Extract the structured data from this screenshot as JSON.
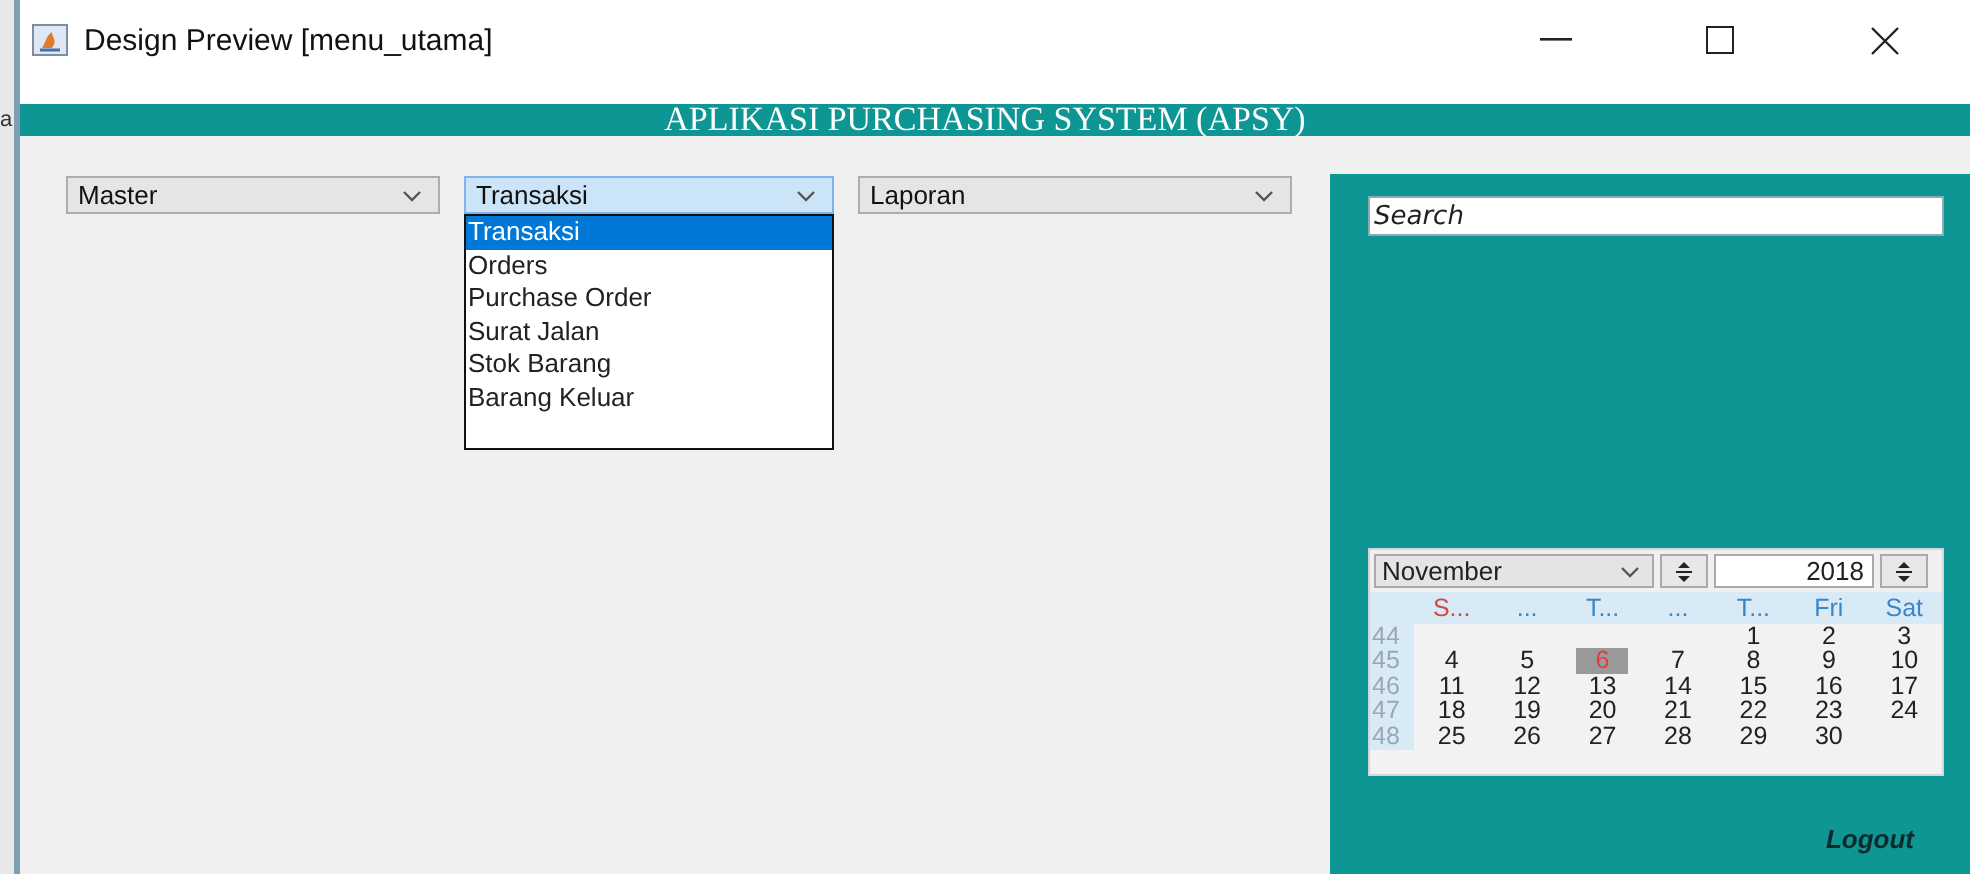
{
  "background_fragment": "a",
  "window": {
    "title": "Design Preview [menu_utama]"
  },
  "banner": {
    "title": "APLIKASI PURCHASING SYSTEM (APSY)"
  },
  "menus": [
    {
      "label": "Master",
      "expanded": false
    },
    {
      "label": "Transaksi",
      "expanded": true,
      "items": [
        {
          "label": "Transaksi",
          "selected": true
        },
        {
          "label": "Orders",
          "selected": false
        },
        {
          "label": "Purchase Order",
          "selected": false
        },
        {
          "label": "Surat Jalan",
          "selected": false
        },
        {
          "label": "Stok Barang",
          "selected": false
        },
        {
          "label": "Barang Keluar",
          "selected": false
        }
      ]
    },
    {
      "label": "Laporan",
      "expanded": false
    }
  ],
  "search": {
    "placeholder": "Search"
  },
  "calendar": {
    "month": "November",
    "year": "2018",
    "weekdays": [
      {
        "label": "S...",
        "color": "#d04848"
      },
      {
        "label": "...",
        "color": "#3a86c8"
      },
      {
        "label": "T...",
        "color": "#3a86c8"
      },
      {
        "label": "...",
        "color": "#3a86c8"
      },
      {
        "label": "T...",
        "color": "#3a86c8"
      },
      {
        "label": "Fri",
        "color": "#3a86c8"
      },
      {
        "label": "Sat",
        "color": "#3a86c8"
      }
    ],
    "weeks": [
      {
        "week": "44",
        "kind": "partial_start",
        "days": [
          {
            "label": "1",
            "selected": false
          },
          {
            "label": "2",
            "selected": false
          },
          {
            "label": "3",
            "selected": false
          }
        ]
      },
      {
        "week": "45",
        "days": [
          {
            "label": "4",
            "selected": false
          },
          {
            "label": "5",
            "selected": false
          },
          {
            "label": "6",
            "selected": true
          },
          {
            "label": "7",
            "selected": false
          },
          {
            "label": "8",
            "selected": false
          },
          {
            "label": "9",
            "selected": false
          },
          {
            "label": "10",
            "selected": false
          }
        ]
      },
      {
        "week": "46",
        "days": [
          {
            "label": "11",
            "selected": false
          },
          {
            "label": "12",
            "selected": false
          },
          {
            "label": "13",
            "selected": false
          },
          {
            "label": "14",
            "selected": false
          },
          {
            "label": "15",
            "selected": false
          },
          {
            "label": "16",
            "selected": false
          },
          {
            "label": "17",
            "selected": false
          }
        ]
      },
      {
        "week": "47",
        "days": [
          {
            "label": "18",
            "selected": false
          },
          {
            "label": "19",
            "selected": false
          },
          {
            "label": "20",
            "selected": false
          },
          {
            "label": "21",
            "selected": false
          },
          {
            "label": "22",
            "selected": false
          },
          {
            "label": "23",
            "selected": false
          },
          {
            "label": "24",
            "selected": false
          }
        ]
      },
      {
        "week": "48",
        "days": [
          {
            "label": "25",
            "selected": false
          },
          {
            "label": "26",
            "selected": false
          },
          {
            "label": "27",
            "selected": false
          },
          {
            "label": "28",
            "selected": false
          },
          {
            "label": "29",
            "selected": false
          },
          {
            "label": "30",
            "selected": false
          }
        ],
        "kind": "partial_end"
      }
    ]
  },
  "logout": "Logout"
}
